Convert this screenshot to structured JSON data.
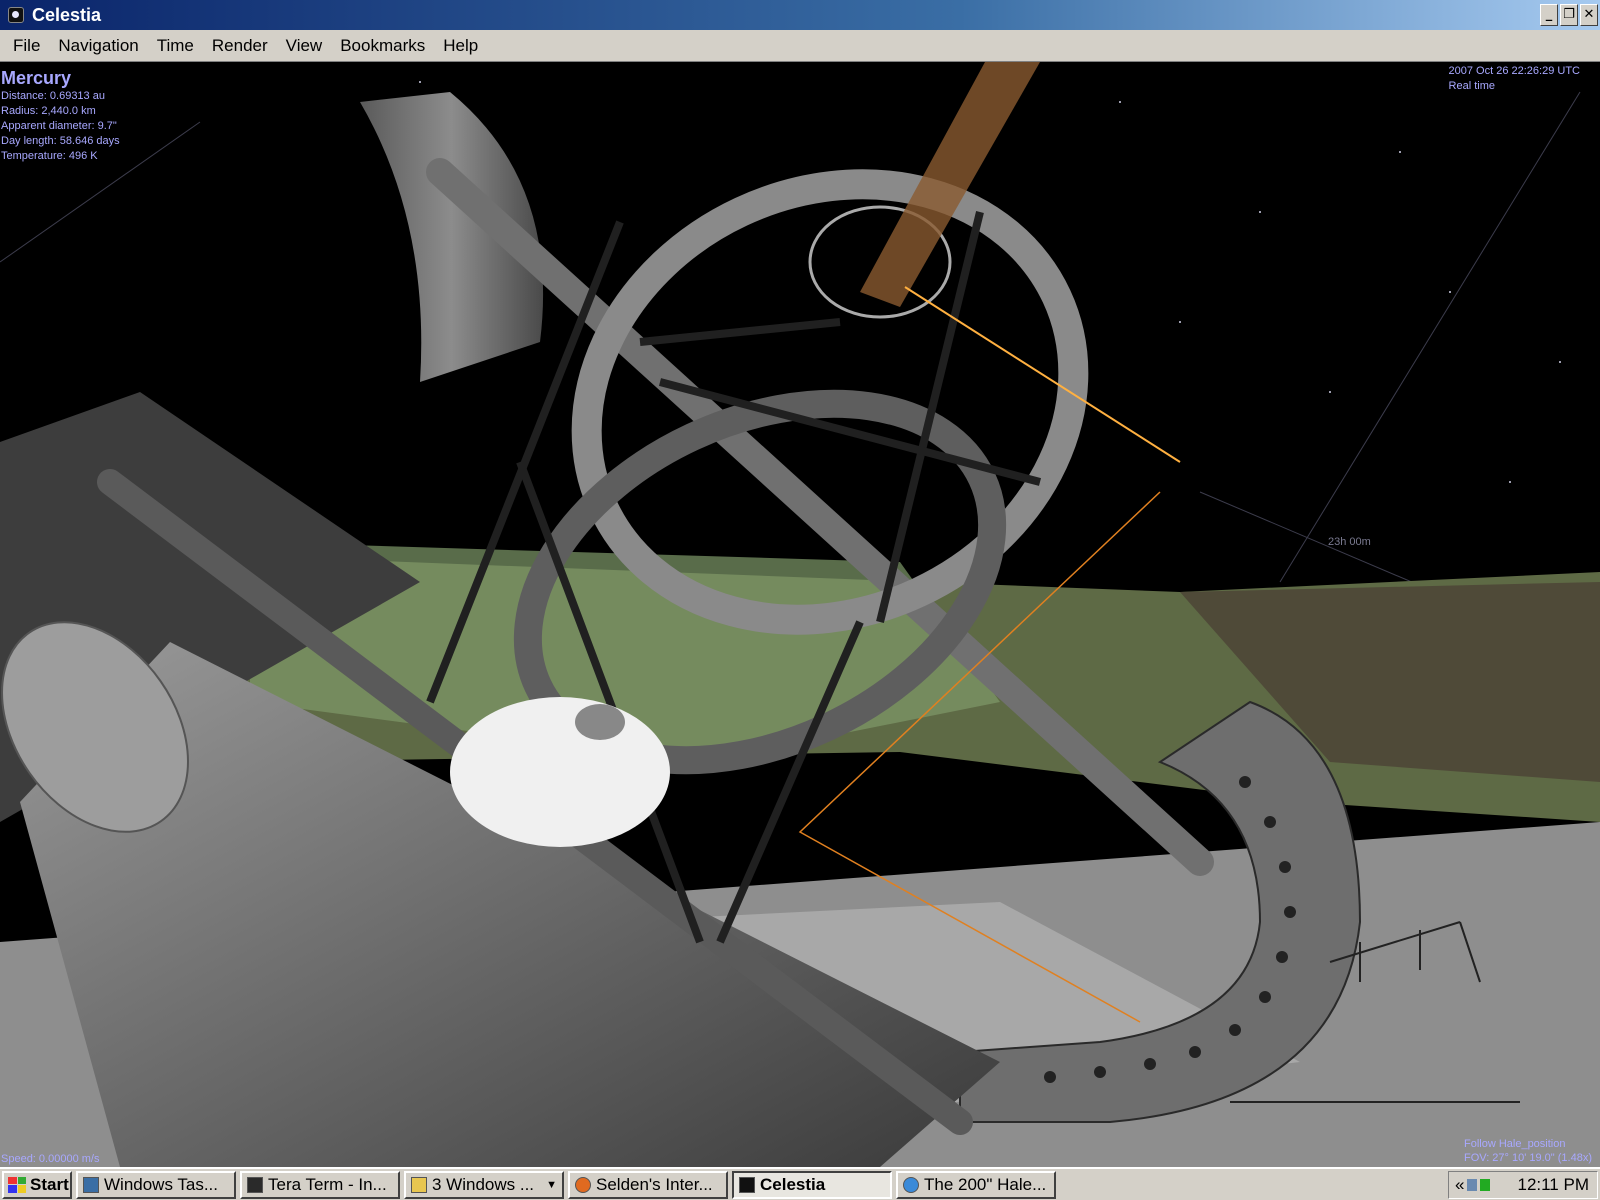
{
  "window": {
    "title": "Celestia",
    "minimize_glyph": "_",
    "restore_glyph": "❐",
    "close_glyph": "✕"
  },
  "menu": [
    "File",
    "Navigation",
    "Time",
    "Render",
    "View",
    "Bookmarks",
    "Help"
  ],
  "hud": {
    "object_name": "Mercury",
    "info": [
      "Distance: 0.69313 au",
      "Radius: 2,440.0 km",
      "Apparent diameter: 9.7\"",
      "Day length: 58.646 days",
      "Temperature: 496 K"
    ],
    "datetime": "2007 Oct 26 22:26:29 UTC",
    "time_mode": "Real time",
    "speed": "Speed: 0.00000 m/s",
    "follow": "Follow Hale_position",
    "fov": "FOV: 27° 10' 19.0\" (1.48x)",
    "grid_label": "23h 00m"
  },
  "taskbar": {
    "start_label": "Start",
    "tasks": [
      {
        "label": "Windows Tas...",
        "icon": "task-manager-icon",
        "active": false
      },
      {
        "label": "Tera Term - In...",
        "icon": "terminal-icon",
        "active": false
      },
      {
        "label": "3 Windows ...",
        "icon": "folder-icon",
        "active": false
      },
      {
        "label": "Selden's Inter...",
        "icon": "firefox-icon",
        "active": false
      },
      {
        "label": "Celestia",
        "icon": "celestia-icon",
        "active": true
      },
      {
        "label": "The 200\" Hale...",
        "icon": "ie-icon",
        "active": false
      }
    ],
    "tray_chevron": "«",
    "clock": "12:11 PM"
  },
  "colors": {
    "hud_text": "#a8a8ff",
    "title_gradient_start": "#0a246a",
    "chrome": "#d4d0c8"
  }
}
